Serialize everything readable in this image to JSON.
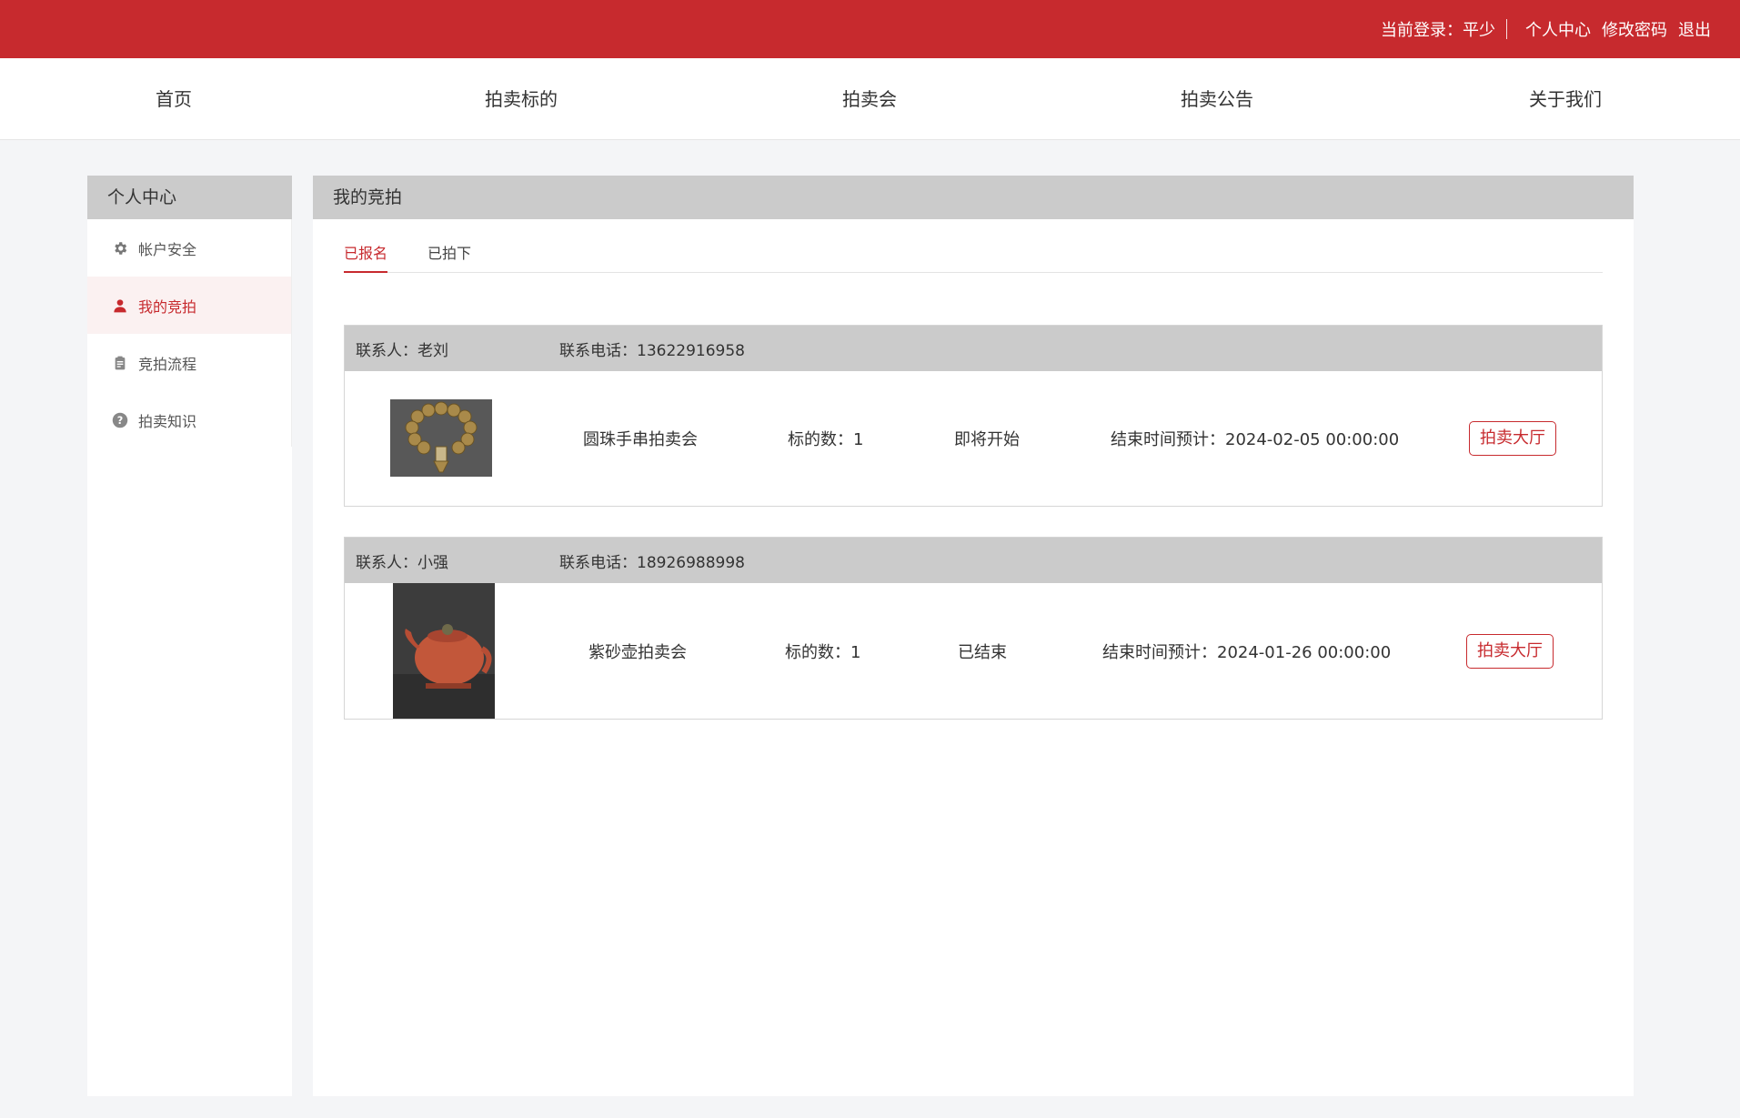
{
  "topbar": {
    "login_label": "当前登录：平少",
    "links": [
      "个人中心",
      "修改密码",
      "退出"
    ]
  },
  "nav": [
    "首页",
    "拍卖标的",
    "拍卖会",
    "拍卖公告",
    "关于我们"
  ],
  "sidebar": {
    "title": "个人中心",
    "items": [
      {
        "label": "帐户安全",
        "icon": "gear-icon"
      },
      {
        "label": "我的竞拍",
        "icon": "user-icon",
        "active": true
      },
      {
        "label": "竞拍流程",
        "icon": "clipboard-icon"
      },
      {
        "label": "拍卖知识",
        "icon": "question-icon"
      }
    ]
  },
  "main": {
    "title": "我的竞拍",
    "tabs": [
      "已报名",
      "已拍下"
    ],
    "active_tab": "已报名",
    "records": [
      {
        "contact": "联系人：老刘",
        "phone": "联系电话：13622916958",
        "image": "prayer-beads-bracelet",
        "auction": "圆珠手串拍卖会",
        "lot_count": "标的数：1",
        "status": "即将开始",
        "end_time": "结束时间预计：2024-02-05 00:00:00",
        "button": "拍卖大厅"
      },
      {
        "contact": "联系人：小强",
        "phone": "联系电话：18926988998",
        "image": "clay-teapot",
        "auction": "紫砂壶拍卖会",
        "lot_count": "标的数：1",
        "status": "已结束",
        "end_time": "结束时间预计：2024-01-26 00:00:00",
        "button": "拍卖大厅"
      }
    ]
  },
  "colors": {
    "brand": "#c72a2e",
    "header_gray": "#cbcbcb",
    "page_bg": "#f4f5f7"
  }
}
